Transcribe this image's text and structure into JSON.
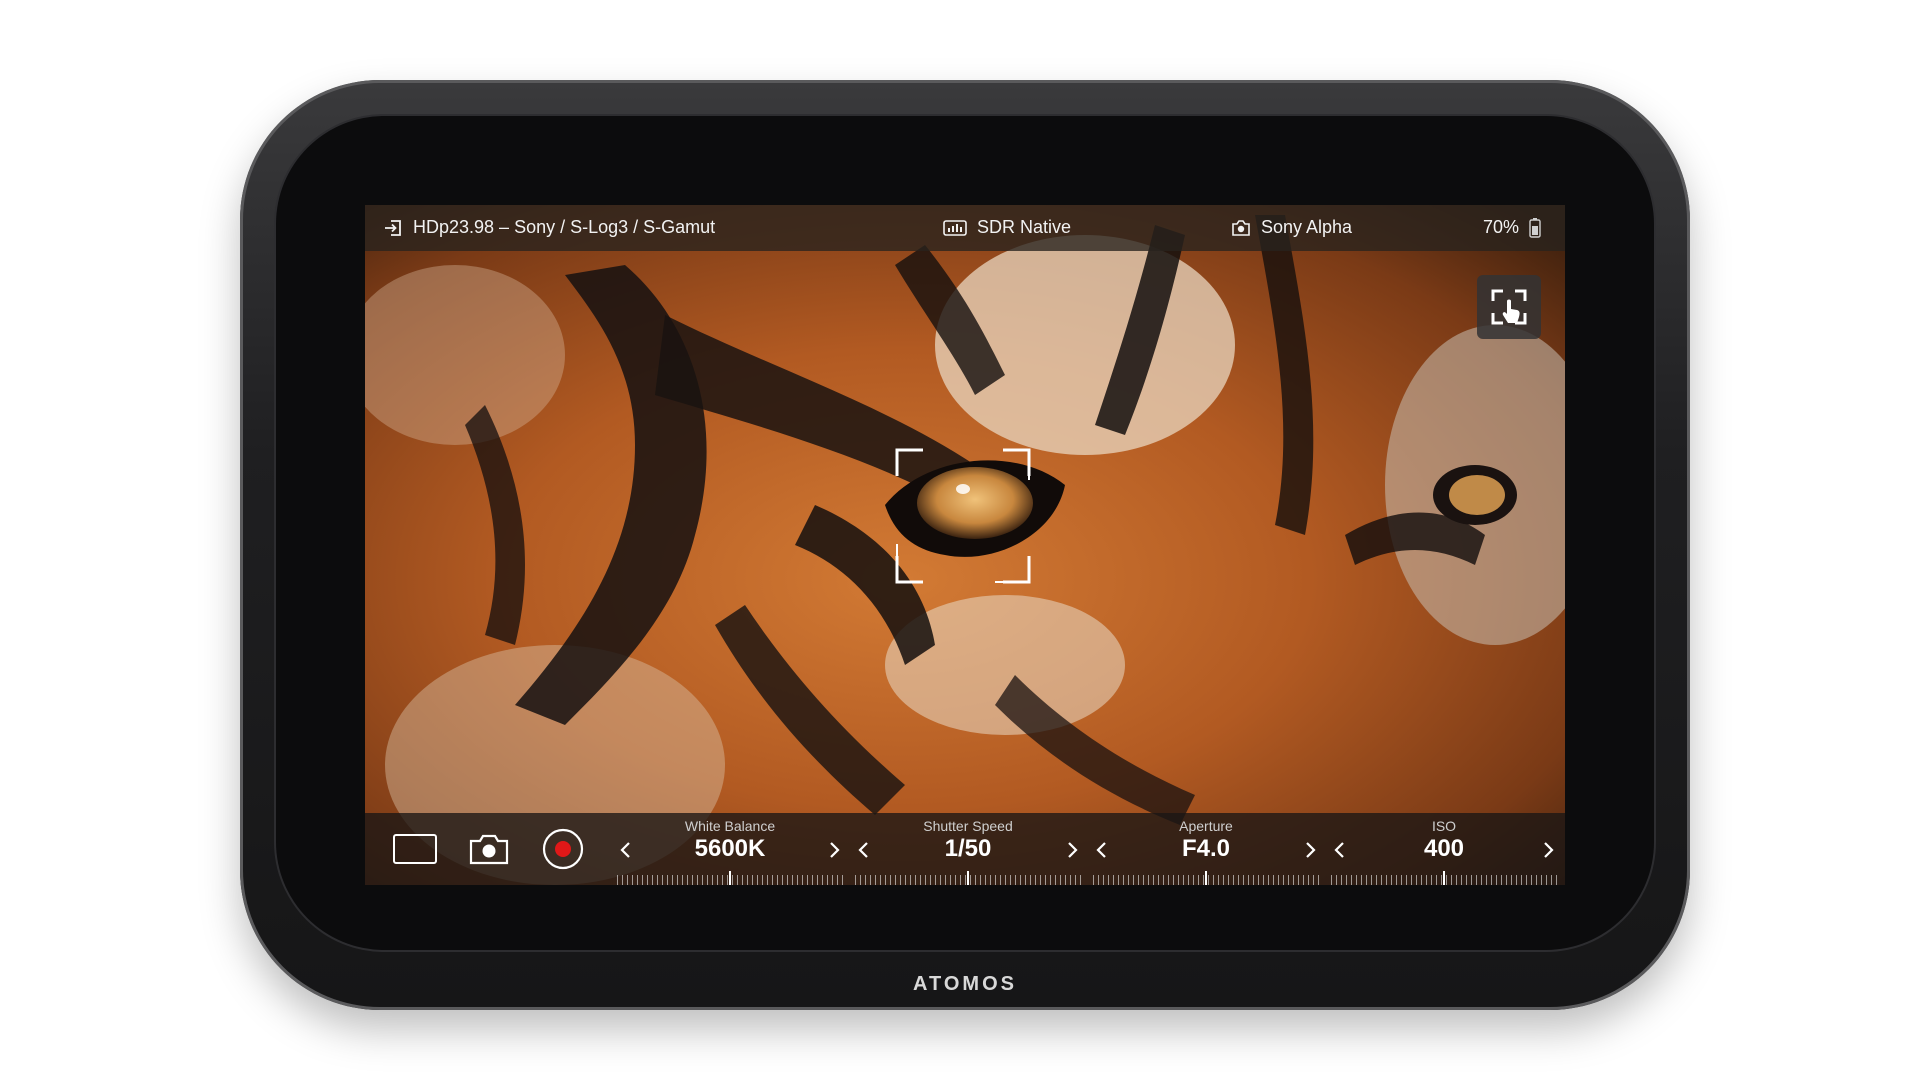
{
  "device": {
    "brand": "ATOMOS"
  },
  "status_bar": {
    "input": "HDp23.98 – Sony / S-Log3 / S-Gamut",
    "monitor_mode": "SDR Native",
    "camera": "Sony Alpha",
    "battery": "70%"
  },
  "controls": {
    "white_balance": {
      "label": "White Balance",
      "value": "5600K"
    },
    "shutter_speed": {
      "label": "Shutter Speed",
      "value": "1/50"
    },
    "aperture": {
      "label": "Aperture",
      "value": "F4.0"
    },
    "iso": {
      "label": "ISO",
      "value": "400"
    }
  },
  "colors": {
    "record": "#e01818",
    "bar_text": "#ffffff"
  },
  "icons": [
    "input-icon",
    "monitor-icon",
    "camera-icon",
    "battery-icon",
    "touch-expand-icon",
    "frame-guide-icon",
    "snapshot-icon",
    "record-icon",
    "chevron-left-icon",
    "chevron-right-icon"
  ]
}
